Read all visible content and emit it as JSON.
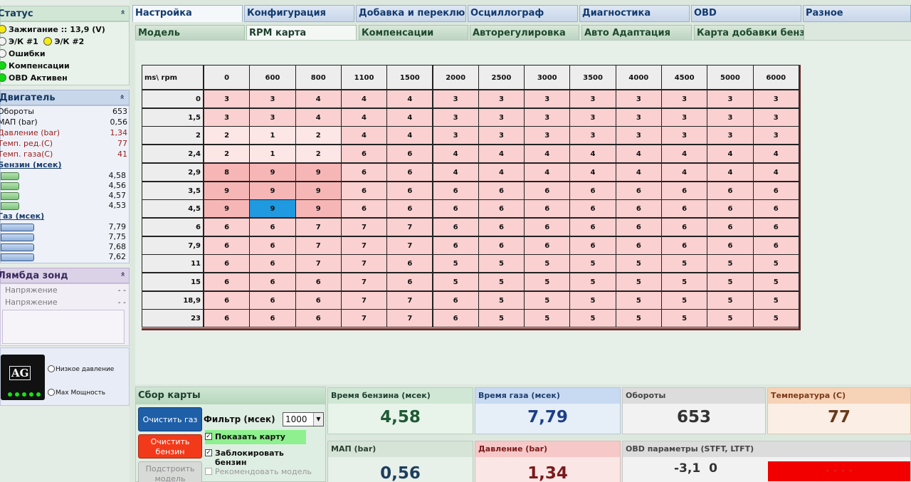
{
  "status": {
    "title": "Статус",
    "chevron": "«",
    "ignition": "Зажигание :: 13,9 (V)",
    "ek1": "Э/К #1",
    "ek2": "Э/К #2",
    "errors": "Ошибки",
    "compensation": "Компенсации",
    "obd_active": "OBD Активен"
  },
  "engine": {
    "title": "Двигатель",
    "chevron": "«",
    "rows": [
      {
        "label": "Обороты",
        "value": "653"
      },
      {
        "label": "МАП (bar)",
        "value": "0,56"
      },
      {
        "label": "Давление (bar)",
        "value": "1,34"
      },
      {
        "label": "Темп. ред.(С)",
        "value": "77"
      },
      {
        "label": "Темп. газа(С)",
        "value": "41"
      }
    ],
    "petrol_group": "Бензин (мсек)",
    "petrol_values": [
      "4,58",
      "4,56",
      "4,57",
      "4,53"
    ],
    "gas_group": "Газ (мсек)",
    "gas_values": [
      "7,79",
      "7,75",
      "7,68",
      "7,62"
    ]
  },
  "lambda": {
    "title": "Лямбда зонд",
    "chevron": "«",
    "rows": [
      {
        "label": "Напряжение",
        "value": "- -"
      },
      {
        "label": "Напряжение",
        "value": "- -"
      }
    ]
  },
  "ag": {
    "logo_text": "AG",
    "low_pressure": "Низкое давление",
    "max_power": "Max Мощность"
  },
  "tabs": [
    "Настройка",
    "Конфигурация",
    "Добавка и переключение",
    "Осциллограф",
    "Диагностика",
    "OBD",
    "Разное"
  ],
  "subtabs": [
    "Модель",
    "RPM карта",
    "Компенсации",
    "Авторегулировка",
    "Авто Адаптация",
    "Карта добавки бензина"
  ],
  "map": {
    "corner": "ms\\ rpm",
    "rpm": [
      "0",
      "600",
      "800",
      "1100",
      "1500",
      "2000",
      "2500",
      "3000",
      "3500",
      "4000",
      "4500",
      "5000",
      "6000"
    ],
    "ms": [
      "0",
      "1,5",
      "2",
      "2,4",
      "2,9",
      "3,5",
      "4,5",
      "6",
      "7,9",
      "11",
      "15",
      "18,9",
      "23"
    ],
    "values": [
      [
        3,
        3,
        4,
        4,
        4,
        3,
        3,
        3,
        3,
        3,
        3,
        3,
        3
      ],
      [
        3,
        3,
        4,
        4,
        4,
        3,
        3,
        3,
        3,
        3,
        3,
        3,
        3
      ],
      [
        2,
        1,
        2,
        4,
        4,
        3,
        3,
        3,
        3,
        3,
        3,
        3,
        3
      ],
      [
        2,
        1,
        2,
        6,
        6,
        4,
        4,
        4,
        4,
        4,
        4,
        4,
        4
      ],
      [
        8,
        9,
        9,
        6,
        6,
        4,
        4,
        4,
        4,
        4,
        4,
        4,
        4
      ],
      [
        9,
        9,
        9,
        6,
        6,
        6,
        6,
        6,
        6,
        6,
        6,
        6,
        6
      ],
      [
        9,
        9,
        9,
        6,
        6,
        6,
        6,
        6,
        6,
        6,
        6,
        6,
        6
      ],
      [
        6,
        6,
        7,
        7,
        7,
        6,
        6,
        6,
        6,
        6,
        6,
        6,
        6
      ],
      [
        6,
        6,
        7,
        7,
        7,
        6,
        6,
        6,
        6,
        6,
        6,
        6,
        6
      ],
      [
        6,
        6,
        7,
        7,
        6,
        5,
        5,
        5,
        5,
        5,
        5,
        5,
        5
      ],
      [
        6,
        6,
        6,
        7,
        6,
        5,
        5,
        5,
        5,
        5,
        5,
        5,
        5
      ],
      [
        6,
        6,
        6,
        7,
        7,
        6,
        5,
        5,
        5,
        5,
        5,
        5,
        5
      ],
      [
        6,
        6,
        6,
        7,
        7,
        6,
        5,
        5,
        5,
        5,
        5,
        5,
        5
      ]
    ],
    "selected": {
      "row": 6,
      "col": 1
    },
    "colors": {
      "low": "#fde6e6",
      "mid": "#fbd0d0",
      "high": "#f7b6b6",
      "selected": "#1f9ae0"
    }
  },
  "collect": {
    "title": "Сбор карты",
    "clear_gas": "Очистить газ",
    "clear_petrol": "Очистить бензин",
    "build_model": "Подстроить модель",
    "filter_label": "Фильтр (мсек)",
    "filter_value": "1000",
    "show_map": "Показать карту",
    "lock_petrol": "Заблокировать бензин",
    "recommend_petrol": "Рекомендовать модель",
    "check_mark": "✓"
  },
  "tiles": {
    "petrol": {
      "label": "Время бензина (мсек)",
      "value": "4,58"
    },
    "gas": {
      "label": "Время газа (мсек)",
      "value": "7,79"
    },
    "rpm": {
      "label": "Обороты",
      "value": "653"
    },
    "temp": {
      "label": "Температура (С)",
      "value": "77"
    },
    "map": {
      "label": "МАП (bar)",
      "value": "0,56"
    },
    "pressure": {
      "label": "Давление (bar)",
      "value": "1,34"
    },
    "obd": {
      "label": "OBD параметры (STFT, LTFT)",
      "stft": "-3,1",
      "ltft": "0",
      "alert": "- -   - -"
    }
  }
}
